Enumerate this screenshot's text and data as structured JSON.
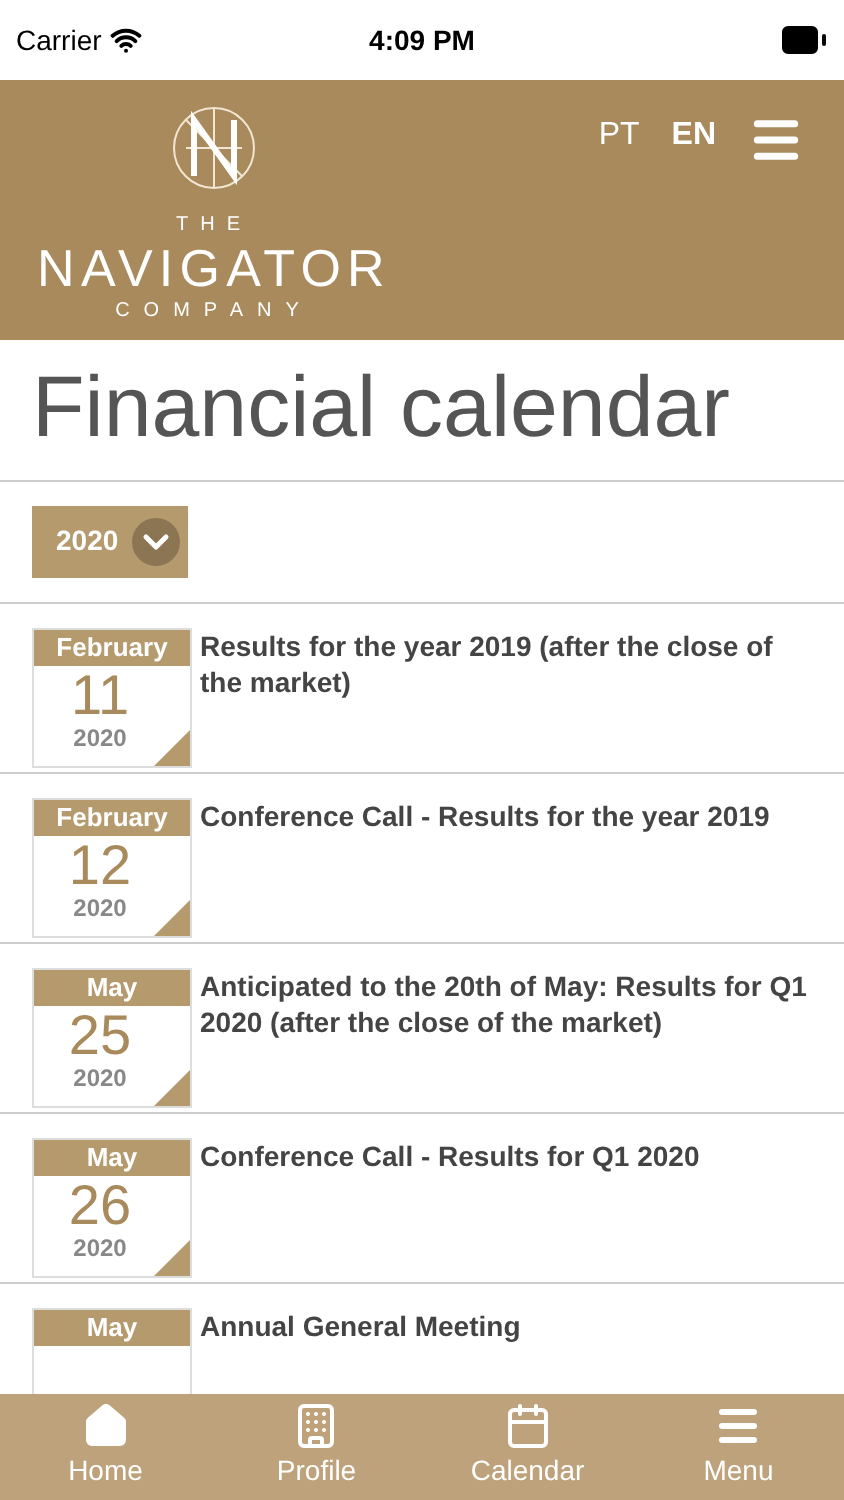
{
  "status_bar": {
    "carrier": "Carrier",
    "time": "4:09 PM"
  },
  "header": {
    "logo": {
      "top": "THE",
      "name": "NAVIGATOR",
      "bottom": "COMPANY"
    },
    "languages": [
      {
        "label": "PT",
        "selected": false
      },
      {
        "label": "EN",
        "selected": true
      }
    ]
  },
  "title": "Financial calendar",
  "year_select": {
    "value": "2020"
  },
  "events": [
    {
      "month": "February",
      "day": "11",
      "year": "2020",
      "text": "Results for the year 2019 (after the close of the market)"
    },
    {
      "month": "February",
      "day": "12",
      "year": "2020",
      "text": "Conference Call - Results for the year 2019"
    },
    {
      "month": "May",
      "day": "25",
      "year": "2020",
      "text": "Anticipated to the 20th of May: Results for Q1 2020 (after the close of the market)"
    },
    {
      "month": "May",
      "day": "26",
      "year": "2020",
      "text": "Conference Call - Results for Q1 2020"
    },
    {
      "month": "May",
      "text": "Annual General Meeting"
    }
  ],
  "tab_bar": [
    {
      "kind": "home",
      "label": "Home"
    },
    {
      "kind": "building",
      "label": "Profile"
    },
    {
      "kind": "calendar",
      "label": "Calendar"
    },
    {
      "kind": "menu",
      "label": "Menu"
    }
  ]
}
